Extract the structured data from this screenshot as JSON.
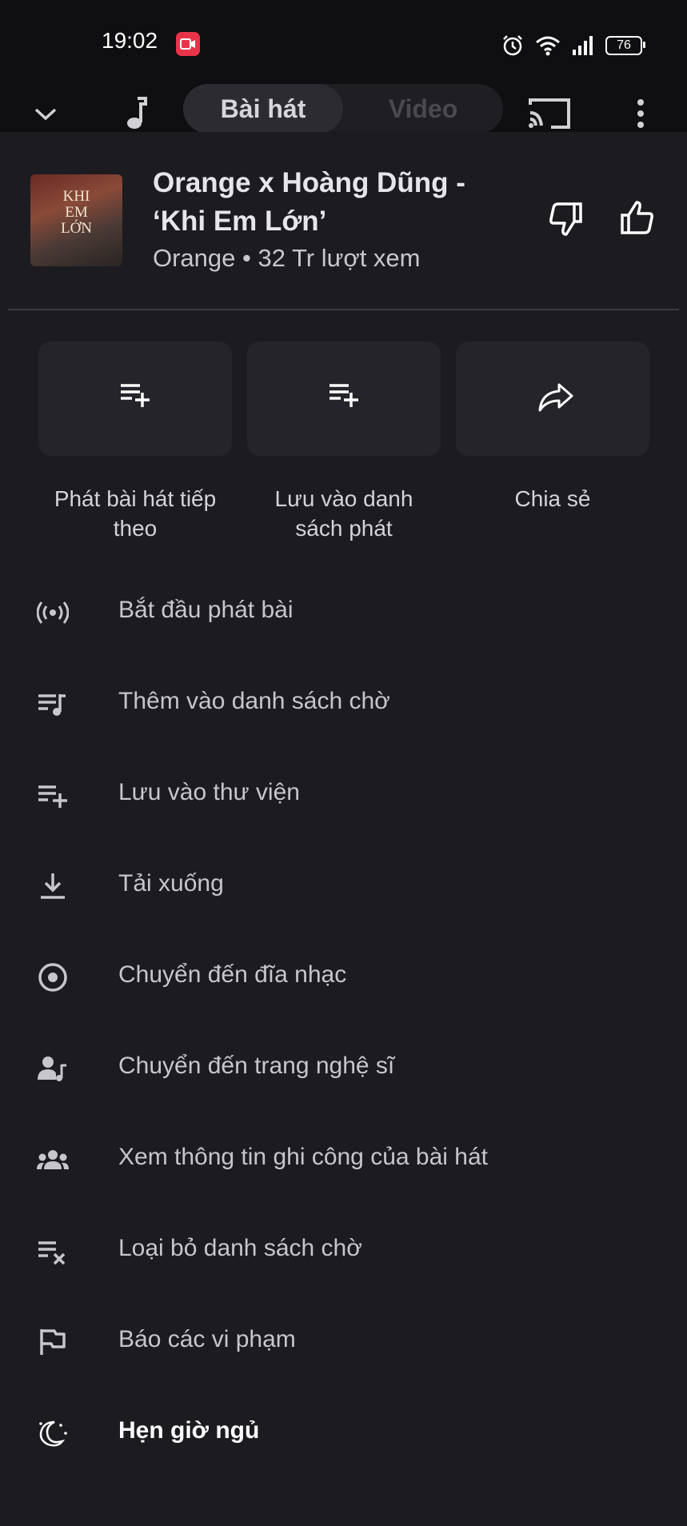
{
  "status_bar": {
    "time": "19:02",
    "battery": "76"
  },
  "player_bar": {
    "tabs": [
      "Bài hát",
      "Video"
    ]
  },
  "song": {
    "title_line1": "Orange x Hoàng Dũng -",
    "title_line2": "‘Khi Em Lớn’",
    "subtitle": "Orange • 32 Tr lượt xem",
    "album_art_text": [
      "KHI",
      "EM",
      "LỚN"
    ]
  },
  "actions": [
    {
      "icon": "playlist-add-icon",
      "label_line1": "Phát bài hát tiếp",
      "label_line2": "theo"
    },
    {
      "icon": "playlist-add-icon",
      "label_line1": "Lưu vào danh",
      "label_line2": "sách phát"
    },
    {
      "icon": "share-icon",
      "label_line1": "Chia sẻ",
      "label_line2": ""
    }
  ],
  "menu": [
    {
      "icon": "radio-icon",
      "label": "Bắt đầu phát bài"
    },
    {
      "icon": "queue-music-icon",
      "label": "Thêm vào danh sách chờ"
    },
    {
      "icon": "library-add-icon",
      "label": "Lưu vào thư viện"
    },
    {
      "icon": "download-icon",
      "label": "Tải xuống"
    },
    {
      "icon": "album-icon",
      "label": "Chuyển đến đĩa nhạc"
    },
    {
      "icon": "artist-icon",
      "label": "Chuyển đến trang nghệ sĩ"
    },
    {
      "icon": "credits-icon",
      "label": "Xem thông tin ghi công của bài hát"
    },
    {
      "icon": "queue-remove-icon",
      "label": "Loại bỏ danh sách chờ"
    },
    {
      "icon": "flag-icon",
      "label": "Báo các vi phạm"
    },
    {
      "icon": "sleep-timer-icon",
      "label": "Hẹn giờ ngủ"
    }
  ]
}
